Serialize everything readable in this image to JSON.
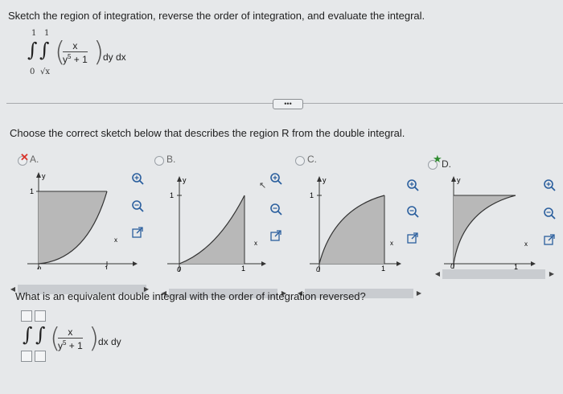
{
  "question1": "Sketch the region of integration, reverse the order of integration, and evaluate the integral.",
  "integral1": {
    "outer_upper": "1",
    "outer_lower": "0",
    "inner_upper": "1",
    "inner_lower": "√x",
    "numerator": "x",
    "denominator_base": "y",
    "denominator_exp": "5",
    "denominator_rest": " + 1",
    "differentials": "dy dx"
  },
  "more_button": "•••",
  "question2": "Choose the correct sketch below that describes the region R from the double integral.",
  "options": [
    {
      "label": "A.",
      "status": "incorrect"
    },
    {
      "label": "B.",
      "status": "none"
    },
    {
      "label": "C.",
      "status": "none"
    },
    {
      "label": "D.",
      "status": "correct"
    }
  ],
  "graph_labels": {
    "y": "y",
    "x": "x",
    "one": "1",
    "zero": "0"
  },
  "question3": "What is an equivalent double integral with the order of integration reversed?",
  "integral2": {
    "numerator": "x",
    "denominator_base": "y",
    "denominator_exp": "5",
    "denominator_rest": " + 1",
    "differentials": "dx dy"
  },
  "colors": {
    "fill": "#b8b8b8",
    "incorrect": "#d9342b",
    "correct": "#2e8b2e",
    "accent": "#2b5f9e"
  }
}
